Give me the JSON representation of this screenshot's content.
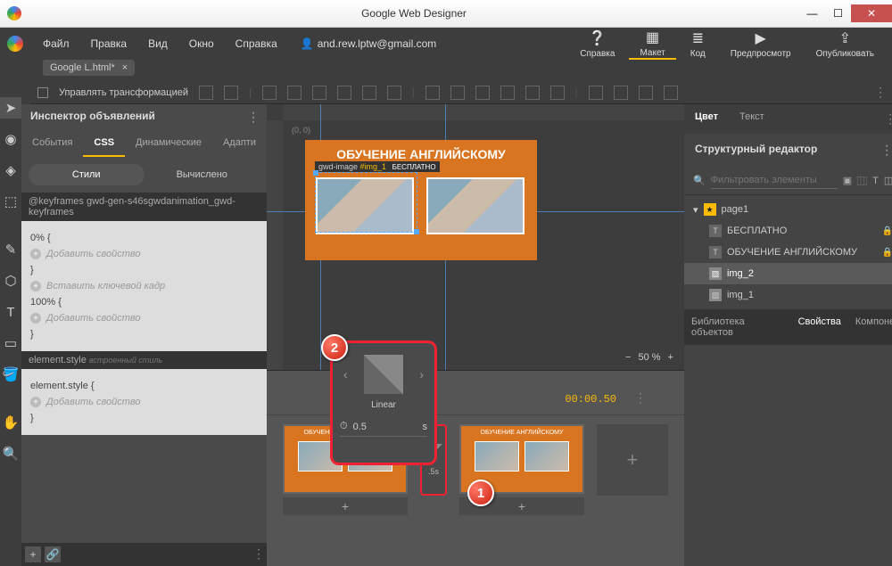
{
  "window": {
    "title": "Google Web Designer"
  },
  "menu": {
    "items": [
      "Файл",
      "Правка",
      "Вид",
      "Окно",
      "Справка"
    ],
    "account": "and.rew.lptw@gmail.com",
    "right": [
      {
        "icon": "?",
        "label": "Справка"
      },
      {
        "icon": "▦",
        "label": "Макет"
      },
      {
        "icon": "≣",
        "label": "Код"
      },
      {
        "icon": "▶",
        "label": "Предпросмотр"
      },
      {
        "icon": "⇪",
        "label": "Опубликовать"
      }
    ]
  },
  "tab": {
    "name": "Google L.html*",
    "close": "×"
  },
  "options": {
    "transform": "Управлять трансформацией"
  },
  "inspector": {
    "title": "Инспектор объявлений",
    "tabs": [
      "События",
      "CSS",
      "Динамические",
      "Адапти"
    ],
    "active_tab": "CSS",
    "mode": {
      "a": "Стили",
      "b": "Вычислено"
    },
    "rule1": "@keyframes gwd-gen-s46sgwdanimation_gwd-keyframes",
    "k0": "0%  {",
    "add_prop": "Добавить свойство",
    "brace": "}",
    "insert_kf": "Вставить ключевой кадр",
    "k100": "100%  {",
    "rule2_label": "element.style",
    "rule2_hint": "встроенный стиль",
    "es_open": "element.style  {"
  },
  "canvas": {
    "coord": "(0, 0)",
    "banner_title": "ОБУЧЕНИЕ АНГЛИЙСКОМУ",
    "sel_el": "gwd-image",
    "sel_id": "#img_1",
    "sub": "БЕСПЛАТНО",
    "zoom": "50 %"
  },
  "timeline": {
    "time": "00:00.50",
    "tr_dur": ".5s"
  },
  "easing": {
    "name": "Linear",
    "value": "0.5",
    "unit": "s"
  },
  "right": {
    "tabs": [
      "Цвет",
      "Текст"
    ],
    "struct_title": "Структурный редактор",
    "search_ph": "Фильтровать элементы",
    "tree": [
      {
        "icon": "star",
        "label": "page1",
        "indent": 0
      },
      {
        "icon": "T",
        "label": "БЕСПЛАТНО",
        "indent": 1,
        "lock": true
      },
      {
        "icon": "T",
        "label": "ОБУЧЕНИЕ АНГЛИЙСКОМУ",
        "indent": 1,
        "lock": true
      },
      {
        "icon": "img",
        "label": "img_2",
        "indent": 1,
        "sel": true
      },
      {
        "icon": "img",
        "label": "img_1",
        "indent": 1
      }
    ],
    "bottom_tabs": [
      "Библиотека объектов",
      "Свойства",
      "Компоне"
    ]
  },
  "callouts": {
    "one": "1",
    "two": "2"
  }
}
